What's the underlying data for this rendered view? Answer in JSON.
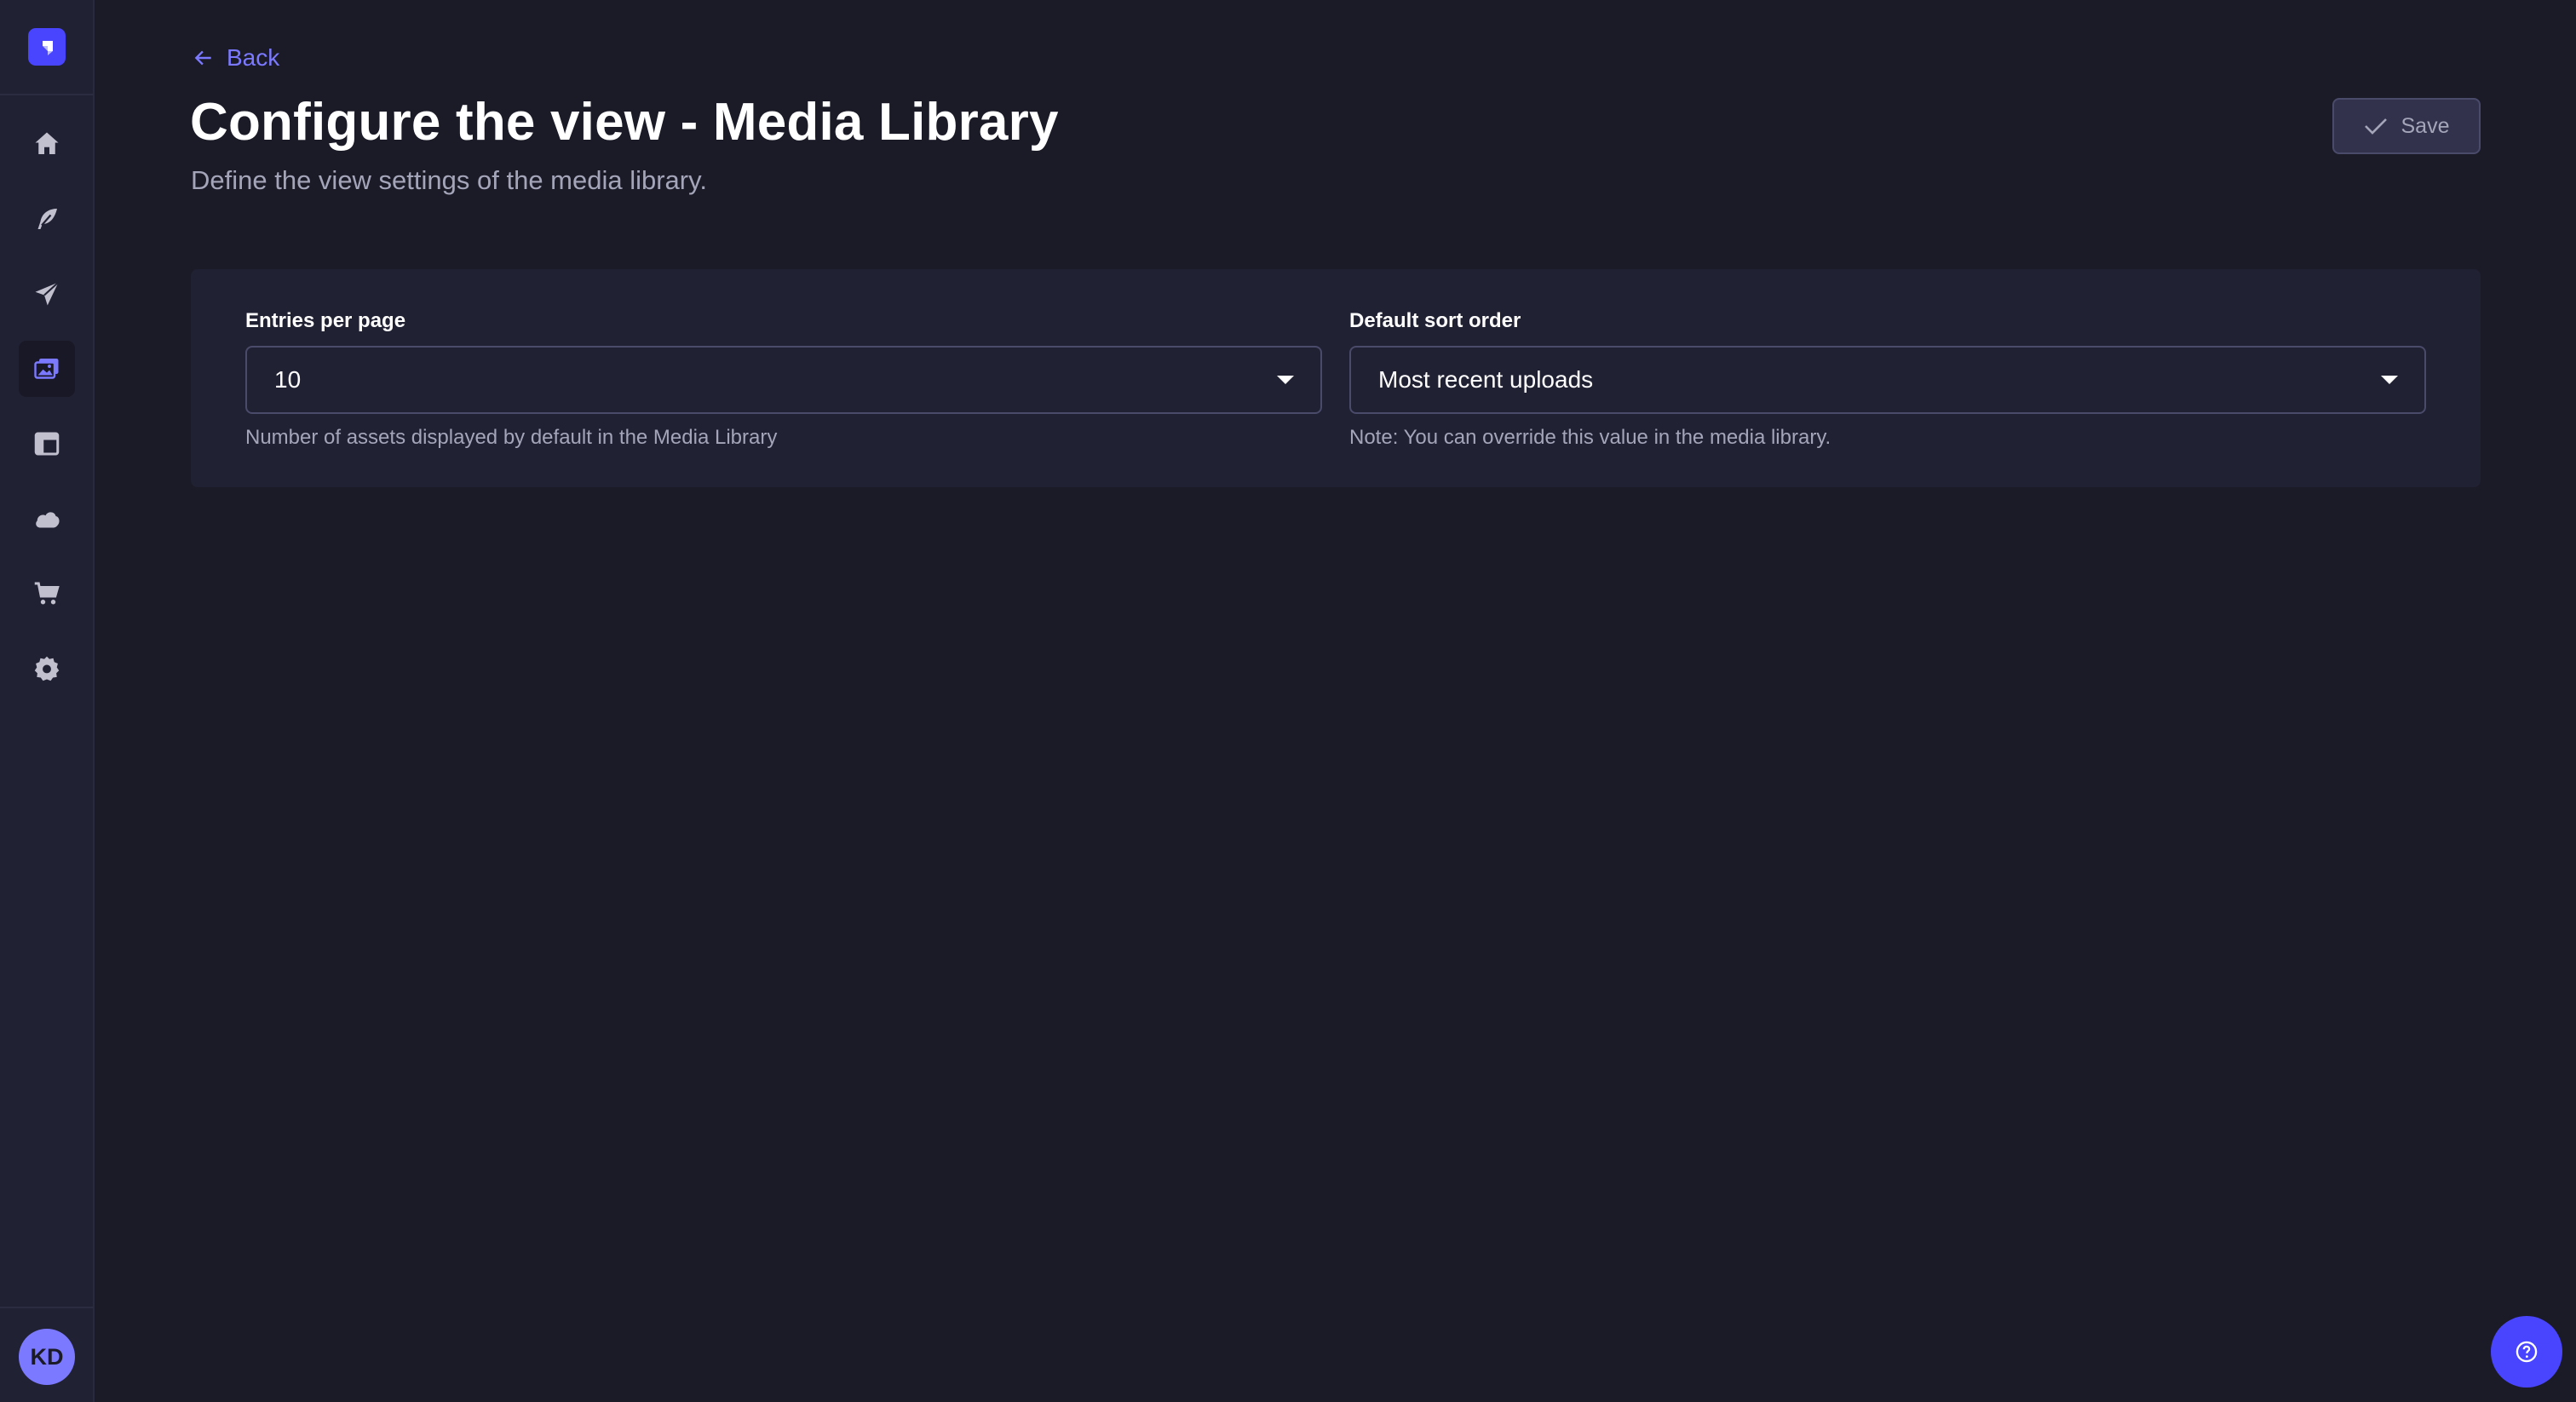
{
  "sidebar": {
    "items": [
      {
        "icon": "home-icon",
        "label": "Home"
      },
      {
        "icon": "feather-icon",
        "label": "Content"
      },
      {
        "icon": "paper-plane-icon",
        "label": "Deploy"
      },
      {
        "icon": "media-library-icon",
        "label": "Media Library",
        "active": true
      },
      {
        "icon": "layout-icon",
        "label": "Layout"
      },
      {
        "icon": "cloud-icon",
        "label": "Cloud"
      },
      {
        "icon": "cart-icon",
        "label": "Marketplace"
      },
      {
        "icon": "gear-icon",
        "label": "Settings"
      }
    ],
    "avatar_initials": "KD"
  },
  "header": {
    "back_label": "Back",
    "title": "Configure the view - Media Library",
    "subtitle": "Define the view settings of the media library.",
    "save_label": "Save"
  },
  "settings": {
    "entries_per_page": {
      "label": "Entries per page",
      "value": "10",
      "hint": "Number of assets displayed by default in the Media Library"
    },
    "default_sort_order": {
      "label": "Default sort order",
      "value": "Most recent uploads",
      "hint": "Note: You can override this value in the media library."
    }
  },
  "colors": {
    "accent": "#4945ff",
    "accent_light": "#7b79ff",
    "background": "#1b1b28",
    "surface": "#212134"
  }
}
